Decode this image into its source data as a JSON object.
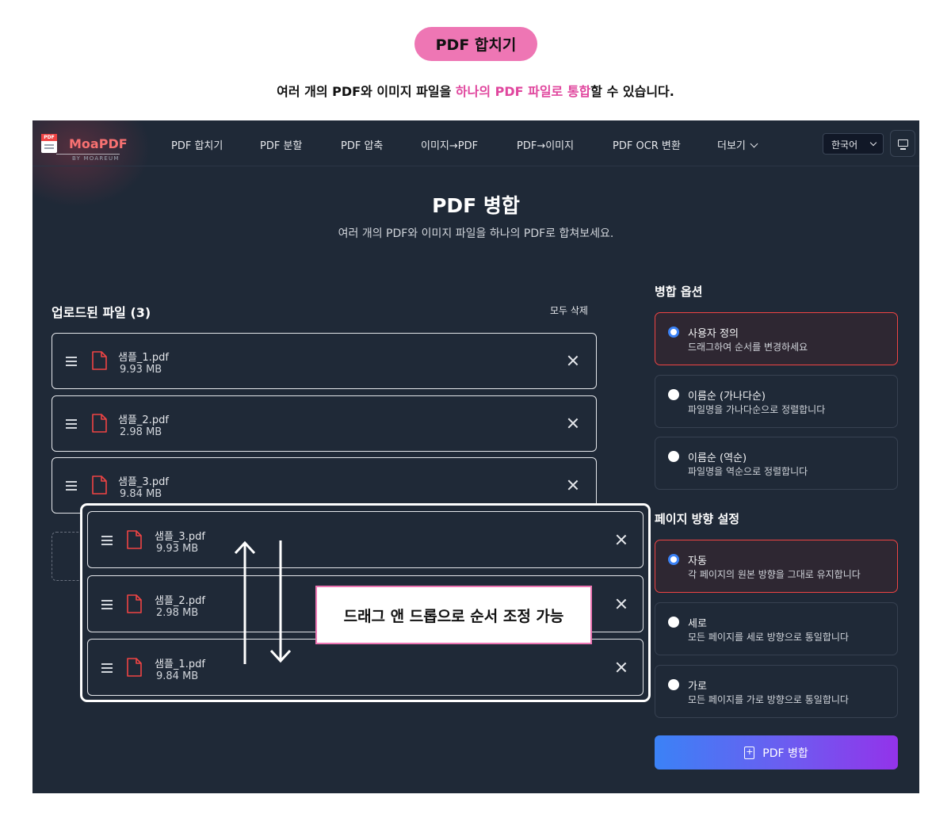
{
  "promo": {
    "pill": "PDF 합치기",
    "tagline_pre": "여러 개의 PDF와 이미지 파일을 ",
    "tagline_highlight": "하나의 PDF 파일로 통합",
    "tagline_post": "할 수 있습니다.",
    "highlight_color": "#e0479e",
    "pill_color": "#ee76b4"
  },
  "nav": {
    "logo_badge": "PDF",
    "logo": "MoaPDF",
    "logo_sub": "BY MOAREUM",
    "items": [
      {
        "label": "PDF 합치기"
      },
      {
        "label": "PDF 분할"
      },
      {
        "label": "PDF 압축"
      },
      {
        "label": "이미지→PDF"
      },
      {
        "label": "PDF→이미지"
      },
      {
        "label": "PDF OCR 변환"
      },
      {
        "label": "더보기"
      }
    ],
    "more_icon": "chevron-down-icon",
    "language": "한국어",
    "display_icon": "monitor-icon"
  },
  "page": {
    "title": "PDF 병합",
    "subtitle": "여러 개의 PDF와 이미지 파일을 하나의 PDF로 합쳐보세요."
  },
  "files": {
    "heading": "업로드된 파일 (3)",
    "delete_all": "모두 삭제",
    "list": [
      {
        "name": "샘플_1.pdf",
        "size": "9.93 MB"
      },
      {
        "name": "샘플_2.pdf",
        "size": "2.98 MB"
      },
      {
        "name": "샘플_3.pdf",
        "size": "9.84 MB"
      }
    ]
  },
  "overlay": {
    "list": [
      {
        "name": "샘플_3.pdf",
        "size": "9.93 MB"
      },
      {
        "name": "샘플_2.pdf",
        "size": "2.98 MB"
      },
      {
        "name": "샘플_1.pdf",
        "size": "9.84 MB"
      }
    ],
    "callout": "드래그 앤 드롭으로 순서 조정 가능"
  },
  "merge_options": {
    "title": "병합 옵션",
    "options": [
      {
        "title": "사용자 정의",
        "desc": "드래그하여 순서를 변경하세요",
        "selected": true
      },
      {
        "title": "이름순 (가나다순)",
        "desc": "파일명을 가나다순으로 정렬합니다",
        "selected": false
      },
      {
        "title": "이름순 (역순)",
        "desc": "파일명을 역순으로 정렬합니다",
        "selected": false
      }
    ]
  },
  "orientation": {
    "title": "페이지 방향 설정",
    "options": [
      {
        "title": "자동",
        "desc": "각 페이지의 원본 방향을 그대로 유지합니다",
        "selected": true
      },
      {
        "title": "세로",
        "desc": "모든 페이지를 세로 방향으로 통일합니다",
        "selected": false
      },
      {
        "title": "가로",
        "desc": "모든 페이지를 가로 방향으로 통일합니다",
        "selected": false
      }
    ]
  },
  "merge_button": "PDF 병합",
  "colors": {
    "app_bg": "#1f2937",
    "selected_border": "#ef4444",
    "radio_selected": "#3b82f6",
    "button_gradient_start": "#3b82f6",
    "button_gradient_end": "#9333ea"
  }
}
